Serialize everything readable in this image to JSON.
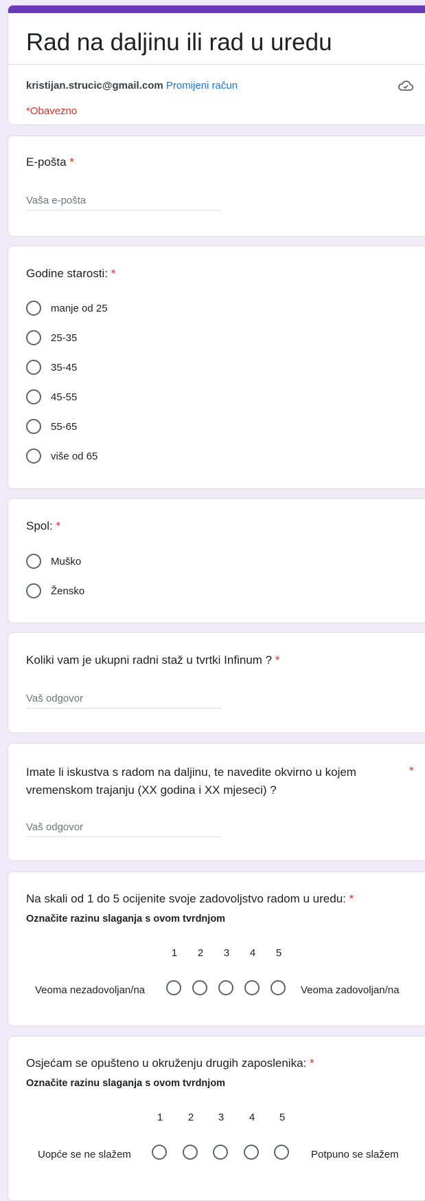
{
  "form": {
    "title": "Rad na daljinu ili rad u uredu",
    "account_email": "kristijan.strucic@gmail.com",
    "switch_account": "Promijeni račun",
    "required_note": "*Obavezno",
    "accent_color": "#673ab7",
    "required_color": "#d93025",
    "link_color": "#1a73e8"
  },
  "required_star": "*",
  "q_email": {
    "title": "E-pošta",
    "placeholder": "Vaša e-pošta"
  },
  "q_age": {
    "title": "Godine starosti:",
    "options": [
      "manje od 25",
      "25-35",
      "35-45",
      "45-55",
      "55-65",
      "više od 65"
    ]
  },
  "q_gender": {
    "title": "Spol:",
    "options": [
      "Muško",
      "Žensko"
    ]
  },
  "q_tenure": {
    "title": "Koliki vam je ukupni radni staž u tvrtki Infinum ?",
    "placeholder": "Vaš odgovor"
  },
  "q_remote": {
    "title_line1": "Imate li iskustva s radom na daljinu, te navedite okvirno u kojem",
    "title_line2": "vremenskom trajanju (XX godina i XX mjeseci) ?",
    "placeholder": "Vaš odgovor"
  },
  "q_office": {
    "title": "Na skali od 1 do 5 ocijenite svoje zadovoljstvo radom u uredu:",
    "subtitle": "Označite razinu slaganja s ovom tvrdnjom",
    "scale": [
      "1",
      "2",
      "3",
      "4",
      "5"
    ],
    "low_label": "Veoma nezadovoljan/na",
    "high_label": "Veoma zadovoljan/na"
  },
  "q_relaxed": {
    "title": "Osjećam se opušteno u okruženju drugih zaposlenika:",
    "subtitle": "Označite razinu slaganja s ovom tvrdnjom",
    "scale": [
      "1",
      "2",
      "3",
      "4",
      "5"
    ],
    "low_label": "Uopće se ne slažem",
    "high_label": "Potpuno se slažem"
  }
}
